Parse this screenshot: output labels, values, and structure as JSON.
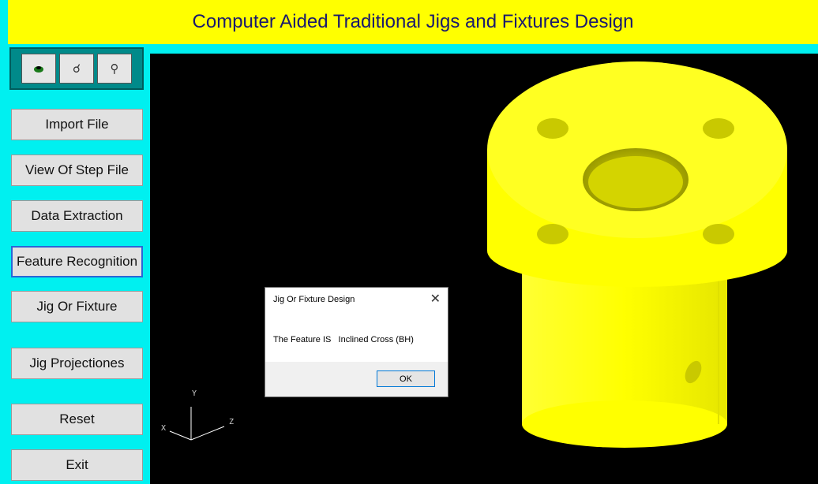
{
  "window": {
    "title": "Computer Aided Traditional Jigs and Fixtures Design"
  },
  "toolbar": {
    "tools": [
      {
        "icon": "rotate-icon"
      },
      {
        "icon": "pan-icon"
      },
      {
        "icon": "zoom-icon"
      }
    ]
  },
  "sidebar": {
    "buttons": [
      {
        "label": "Import File"
      },
      {
        "label": "View Of Step File"
      },
      {
        "label": "Data Extraction"
      },
      {
        "label": "Feature Recognition"
      },
      {
        "label": "Jig Or Fixture"
      },
      {
        "label": "Jig Projectiones"
      },
      {
        "label": "Reset"
      },
      {
        "label": "Exit"
      }
    ]
  },
  "viewport": {
    "background": "#000000",
    "model_color": "#ffff00",
    "axes": {
      "x": "X",
      "y": "Y",
      "z": "Z"
    }
  },
  "dialog": {
    "title": "Jig Or Fixture Design",
    "message": "The Feature IS   Inclined Cross (BH)",
    "ok_label": "OK"
  }
}
